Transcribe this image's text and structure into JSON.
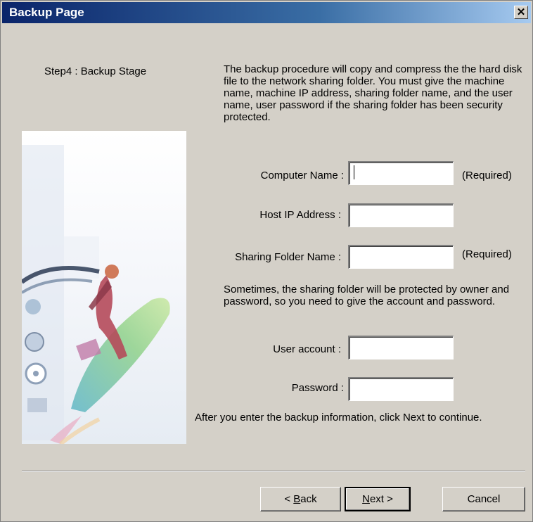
{
  "window": {
    "title": "Backup Page",
    "close_glyph": "✕"
  },
  "step": {
    "label": "Step4 : Backup Stage"
  },
  "intro_text": "The backup procedure will copy and compress the the hard disk file to the network sharing folder. You must give the machine name, machine IP address, sharing folder name, and the user name, user password if the sharing folder has been security protected.",
  "fields": {
    "computer_name": {
      "label": "Computer Name :",
      "value": "",
      "note": "(Required)"
    },
    "host_ip": {
      "label": "Host IP Address :",
      "value": ""
    },
    "sharing_folder": {
      "label": "Sharing Folder Name :",
      "value": "",
      "note": "(Required)"
    },
    "user_account": {
      "label": "User account :",
      "value": ""
    },
    "password": {
      "label": "Password :",
      "value": ""
    }
  },
  "security_text": "Sometimes, the sharing folder will be protected by owner and password, so you need to give the account and password.",
  "footer_text": "After you enter the backup information, click Next to continue.",
  "buttons": {
    "back": {
      "prefix": "< ",
      "accel": "B",
      "rest": "ack"
    },
    "next": {
      "accel": "N",
      "rest": "ext >"
    },
    "cancel": "Cancel"
  },
  "icons": {
    "close": "close-icon",
    "art": "surfer-illustration"
  }
}
